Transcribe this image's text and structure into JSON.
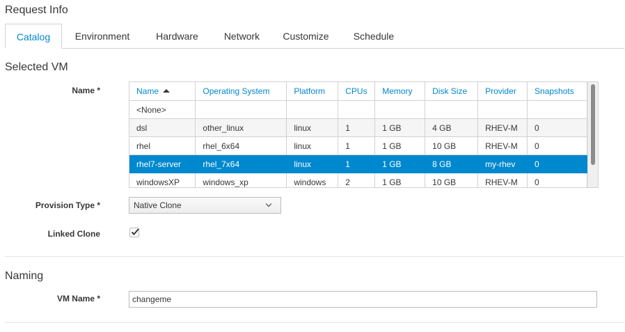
{
  "page": {
    "title": "Request Info"
  },
  "tabs": [
    {
      "label": "Catalog",
      "active": true
    },
    {
      "label": "Environment"
    },
    {
      "label": "Hardware"
    },
    {
      "label": "Network"
    },
    {
      "label": "Customize"
    },
    {
      "label": "Schedule"
    }
  ],
  "selected_vm": {
    "heading": "Selected VM",
    "name_label": "Name *",
    "columns": [
      "Name",
      "Operating System",
      "Platform",
      "CPUs",
      "Memory",
      "Disk Size",
      "Provider",
      "Snapshots"
    ],
    "sort": {
      "column": "Name",
      "direction": "ascending"
    },
    "rows": [
      [
        "<None>",
        "",
        "",
        "",
        "",
        "",
        "",
        ""
      ],
      [
        "dsl",
        "other_linux",
        "linux",
        "1",
        "1 GB",
        "4 GB",
        "RHEV-M",
        "0"
      ],
      [
        "rhel",
        "rhel_6x64",
        "linux",
        "1",
        "1 GB",
        "10 GB",
        "RHEV-M",
        "0"
      ],
      [
        "rhel7-server",
        "rhel_7x64",
        "linux",
        "1",
        "1 GB",
        "8 GB",
        "my-rhev",
        "0"
      ],
      [
        "windowsXP",
        "windows_xp",
        "windows",
        "2",
        "1 GB",
        "10 GB",
        "RHEV-M",
        "0"
      ]
    ],
    "selected_row": 3,
    "provision_type_label": "Provision Type *",
    "provision_type_value": "Native Clone",
    "linked_clone_label": "Linked Clone",
    "linked_clone_checked": true
  },
  "naming": {
    "heading": "Naming",
    "vm_name_label": "VM Name *",
    "vm_name_value": "changeme"
  },
  "colors": {
    "accent": "#0088ce",
    "selected_row_bg": "#0088ce",
    "text": "#363636"
  }
}
